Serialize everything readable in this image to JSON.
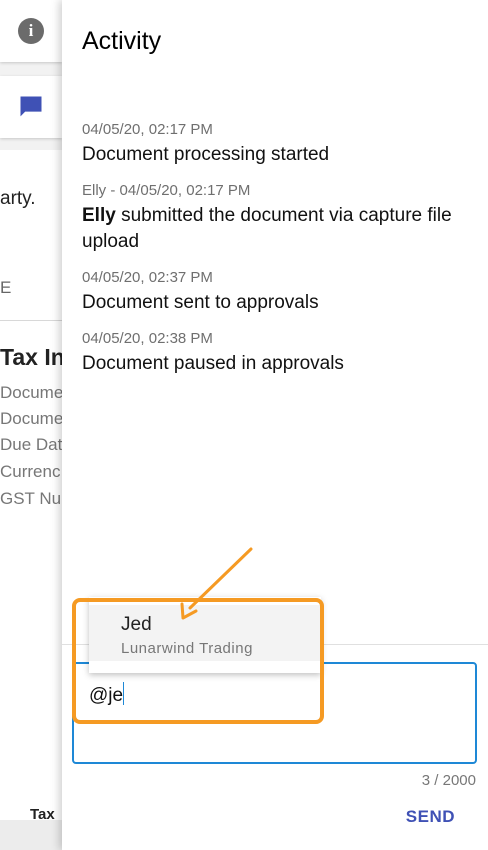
{
  "background": {
    "text_party": "arty.",
    "text_e": "E",
    "doc_title": "Tax In",
    "fields": [
      "Docume",
      "Docume",
      "Due Dat",
      "Currenc",
      "GST Nu"
    ],
    "footer_text": "Tax"
  },
  "drawer": {
    "title": "Activity",
    "activities": [
      {
        "meta": "04/05/20, 02:17 PM",
        "text": "Document processing started"
      },
      {
        "meta": "Elly - 04/05/20, 02:17 PM",
        "actor": "Elly",
        "text": " submitted the document via capture file upload"
      },
      {
        "meta": "04/05/20, 02:37 PM",
        "text": "Document sent to approvals"
      },
      {
        "meta": "04/05/20, 02:38 PM",
        "text": "Document paused in approvals"
      }
    ],
    "comment": {
      "value": "@je",
      "char_count": "3 / 2000",
      "send_label": "SEND"
    },
    "mention_suggestion": {
      "name": "Jed",
      "company": "Lunarwind Trading"
    }
  },
  "colors": {
    "accent_blue": "#1e88d6",
    "send_indigo": "#3f51b5",
    "comment_icon": "#3f51b5",
    "annotation_orange": "#f59a23"
  },
  "icons": {
    "info_tab": "info-icon",
    "comments_tab": "comment-icon"
  }
}
